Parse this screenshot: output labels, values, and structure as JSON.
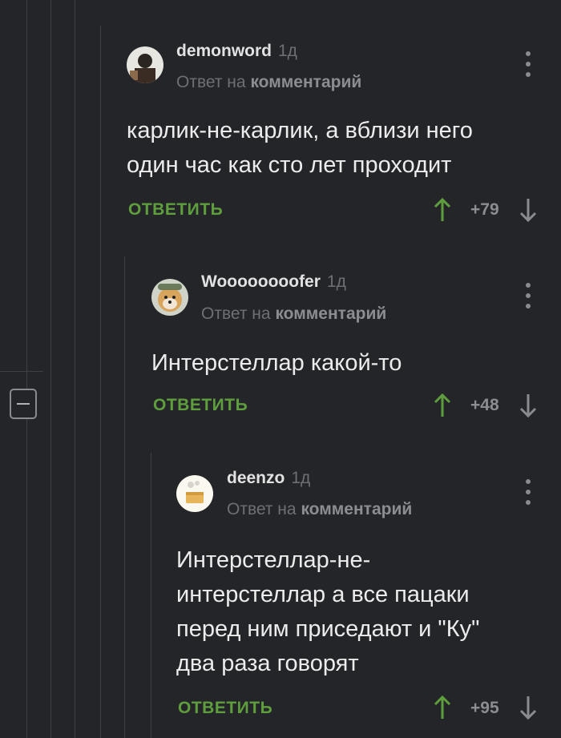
{
  "comments": [
    {
      "author": "demonword",
      "time": "1д",
      "reply_prefix": "Ответ на",
      "reply_target": "комментарий",
      "text_lines": [
        "карлик-не-карлик, а вблизи него",
        "один час как сто лет проходит"
      ],
      "reply_label": "ОТВЕТИТЬ",
      "score": "+79"
    },
    {
      "author": "Woooooooofer",
      "time": "1д",
      "reply_prefix": "Ответ на",
      "reply_target": "комментарий",
      "text_lines": [
        "Интерстеллар какой-то"
      ],
      "reply_label": "ОТВЕТИТЬ",
      "score": "+48"
    },
    {
      "author": "deenzo",
      "time": "1д",
      "reply_prefix": "Ответ на",
      "reply_target": "комментарий",
      "text_lines": [
        "Интерстеллар-не-",
        "интерстеллар а все пацаки",
        "перед ним приседают и \"Ку\"",
        "два раза говорят"
      ],
      "reply_label": "ОТВЕТИТЬ",
      "score": "+95"
    }
  ],
  "colors": {
    "background": "#242529",
    "accent_green": "#5e9e3c",
    "muted": "#6e6f74"
  },
  "icons": {
    "upvote": "arrow-up-icon",
    "downvote": "arrow-down-icon",
    "menu": "more-vertical-icon",
    "collapse": "minus-icon"
  }
}
